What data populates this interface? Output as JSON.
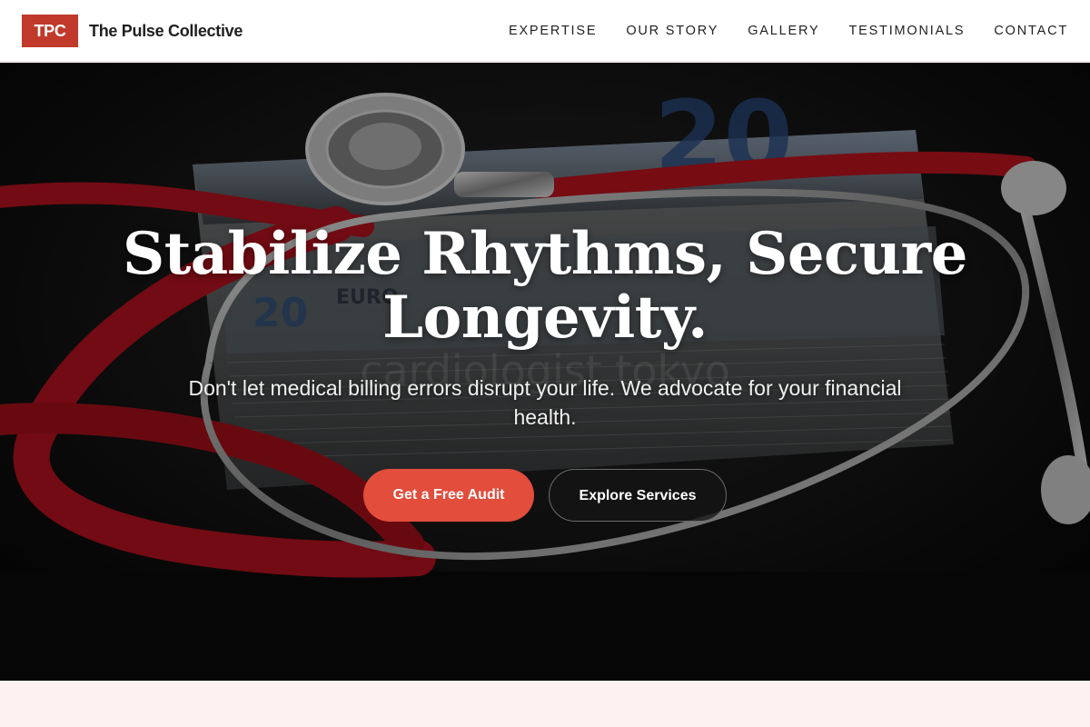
{
  "header": {
    "logo": "TPC",
    "brand": "The Pulse Collective",
    "nav": [
      "EXPERTISE",
      "OUR STORY",
      "GALLERY",
      "TESTIMONIALS",
      "CONTACT"
    ]
  },
  "hero": {
    "title": "Stabilize Rhythms, Secure Longevity.",
    "subtitle": "Don't let medical billing errors disrupt your life. We advocate for your financial health.",
    "primary_button": "Get a Free Audit",
    "secondary_button": "Explore Services",
    "image_watermark": "cardiologist tokyo"
  },
  "colors": {
    "accent": "#c0392b",
    "primary_button": "#e24d3c",
    "hero_overlay": "#000000",
    "page_background": "#fdf2f1"
  }
}
